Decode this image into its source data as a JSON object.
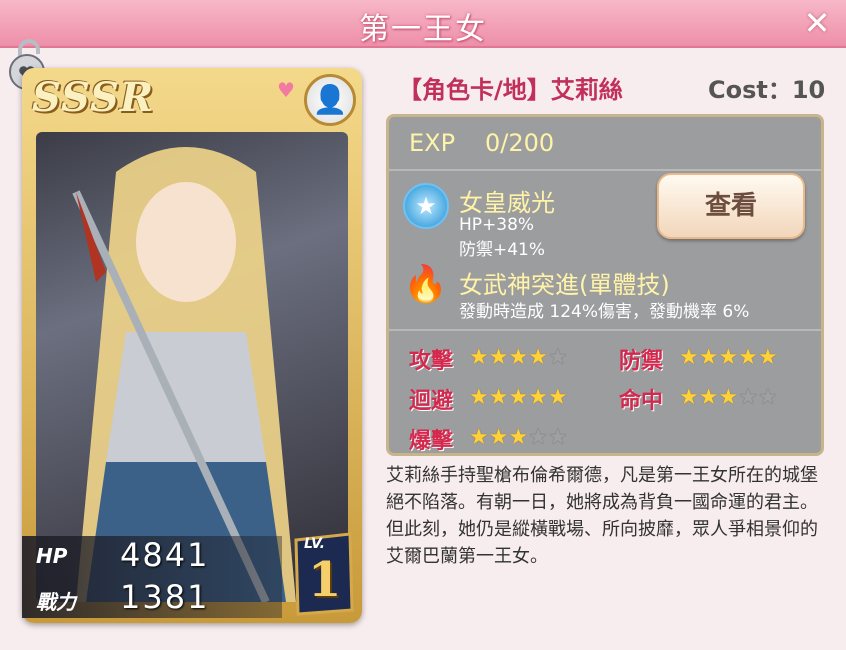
{
  "window": {
    "title": "第一王女"
  },
  "card": {
    "rarity": "SSSR",
    "hp_label": "HP",
    "hp_value": "4841",
    "power_label": "戰力",
    "power_value": "1381",
    "lv_label": "LV.",
    "lv_value": "1"
  },
  "header": {
    "name": "【角色卡/地】艾莉絲",
    "cost": "Cost：10"
  },
  "exp": {
    "label": "EXP",
    "value": "0/200"
  },
  "skill1": {
    "name": "女皇威光",
    "desc1": "HP+38%",
    "desc2": "防禦+41%",
    "icon": "star-badge-icon"
  },
  "view_button": {
    "label": "查看"
  },
  "skill2": {
    "name": "女武神突進(單體技)",
    "desc": "發動時造成 124%傷害，發動機率 6%",
    "icon": "flame-icon"
  },
  "attributes": [
    {
      "label": "攻擊",
      "stars": 4
    },
    {
      "label": "防禦",
      "stars": 5
    },
    {
      "label": "迴避",
      "stars": 5
    },
    {
      "label": "命中",
      "stars": 3
    },
    {
      "label": "爆擊",
      "stars": 3
    }
  ],
  "description": "艾莉絲手持聖槍布倫希爾德，凡是第一王女所在的城堡絕不陷落。有朝一日，她將成為背負一國命運的君主。但此刻，她仍是縱橫戰場、所向披靡，眾人爭相景仰的艾爾巴蘭第一王女。"
}
